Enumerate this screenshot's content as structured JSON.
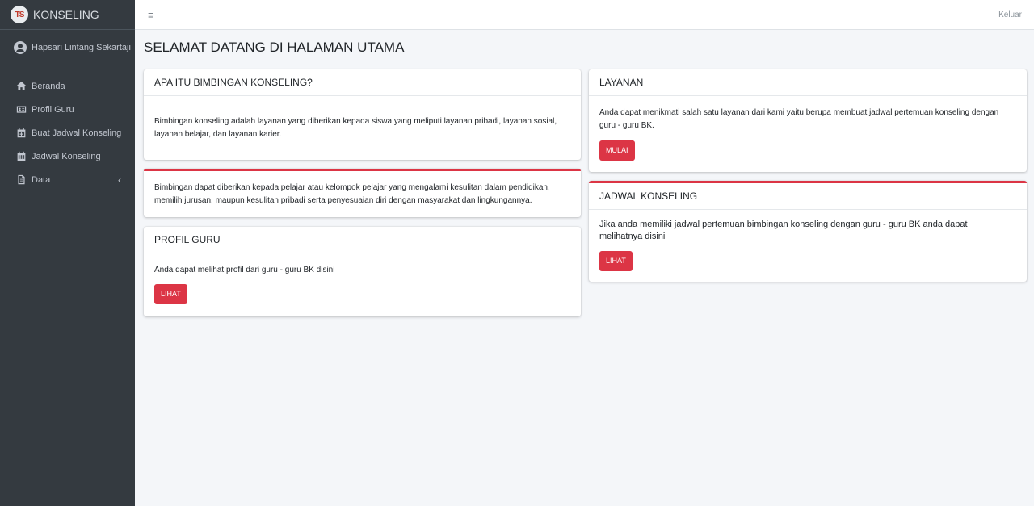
{
  "brand": {
    "name": "KONSELING",
    "logo_text": "TS"
  },
  "user": {
    "name": "Hapsari Lintang Sekartaji"
  },
  "sidebar": {
    "items": [
      {
        "label": "Beranda",
        "icon": "home-icon"
      },
      {
        "label": "Profil Guru",
        "icon": "id-card-icon"
      },
      {
        "label": "Buat Jadwal Konseling",
        "icon": "calendar-plus-icon"
      },
      {
        "label": "Jadwal Konseling",
        "icon": "calendar-icon"
      },
      {
        "label": "Data",
        "icon": "file-icon"
      }
    ]
  },
  "topbar": {
    "menu_icon": "≡",
    "logout_label": "Keluar"
  },
  "page": {
    "title": "SELAMAT DATANG DI HALAMAN UTAMA"
  },
  "cards": {
    "about": {
      "title": "APA ITU BIMBINGAN KONSELING?",
      "body": "Bimbingan konseling adalah layanan yang diberikan kepada siswa yang meliputi layanan pribadi, layanan sosial, layanan belajar, dan layanan karier."
    },
    "about_more": {
      "body": "Bimbingan dapat diberikan kepada pelajar atau kelompok pelajar yang mengalami kesulitan dalam pendidikan, memilih jurusan, maupun kesulitan pribadi serta penyesuaian diri dengan masyarakat dan lingkungannya."
    },
    "profil_guru": {
      "title": "PROFIL GURU",
      "body": "Anda dapat melihat profil dari guru - guru BK disini",
      "button": "LIHAT"
    },
    "layanan": {
      "title": "LAYANAN",
      "body": "Anda dapat menikmati salah satu layanan dari kami yaitu berupa membuat jadwal pertemuan konseling dengan guru - guru BK.",
      "button": "MULAI"
    },
    "jadwal": {
      "title": "JADWAL KONSELING",
      "body": "Jika anda memiliki jadwal pertemuan bimbingan konseling dengan guru - guru BK anda dapat melihatnya disini",
      "button": "LIHAT"
    }
  },
  "colors": {
    "sidebar_bg": "#343a40",
    "accent": "#dc3545",
    "content_bg": "#f4f6f9"
  }
}
